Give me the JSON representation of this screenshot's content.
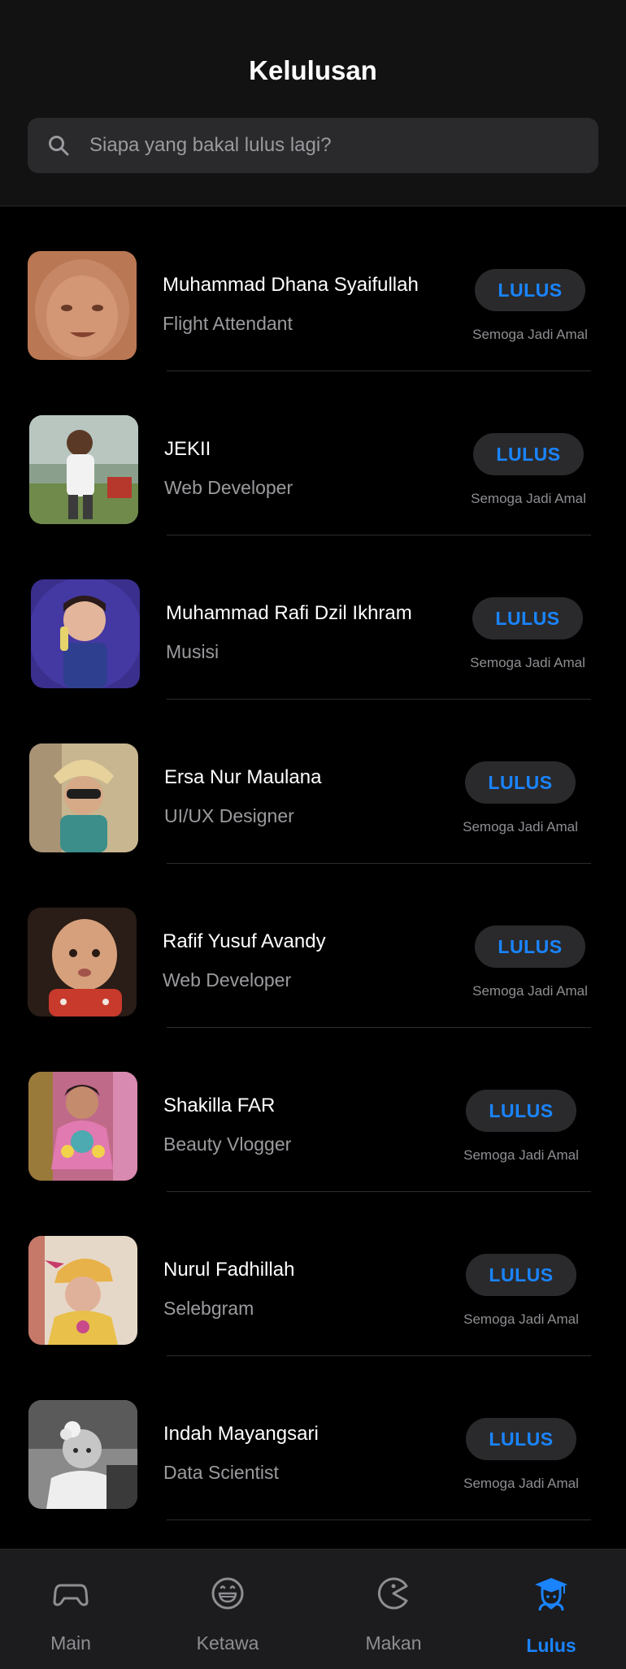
{
  "header": {
    "title": "Kelulusan"
  },
  "search": {
    "placeholder": "Siapa yang bakal lulus lagi?",
    "icon": "search-icon"
  },
  "list": [
    {
      "name": "Muhammad Dhana Syaifullah",
      "role": "Flight Attendant",
      "badge": "LULUS",
      "caption": "Semoga Jadi Amal",
      "avatar": "photo-baby-face"
    },
    {
      "name": "JEKII",
      "role": "Web Developer",
      "badge": "LULUS",
      "caption": "Semoga Jadi Amal",
      "avatar": "photo-child-outdoors"
    },
    {
      "name": "Muhammad Rafi Dzil Ikhram",
      "role": "Musisi",
      "badge": "LULUS",
      "caption": "Semoga Jadi Amal",
      "avatar": "photo-child-blue-background"
    },
    {
      "name": "Ersa Nur Maulana",
      "role": "UI/UX Designer",
      "badge": "LULUS",
      "caption": "Semoga Jadi Amal",
      "avatar": "photo-child-sunglasses"
    },
    {
      "name": "Rafif Yusuf Avandy",
      "role": "Web Developer",
      "badge": "LULUS",
      "caption": "Semoga Jadi Amal",
      "avatar": "photo-baby-red-shirt"
    },
    {
      "name": "Shakilla FAR",
      "role": "Beauty Vlogger",
      "badge": "LULUS",
      "caption": "Semoga Jadi Amal",
      "avatar": "photo-child-costume"
    },
    {
      "name": "Nurul Fadhillah",
      "role": "Selebgram",
      "badge": "LULUS",
      "caption": "Semoga Jadi Amal",
      "avatar": "photo-child-yellow-dress"
    },
    {
      "name": "Indah Mayangsari",
      "role": "Data Scientist",
      "badge": "LULUS",
      "caption": "Semoga Jadi Amal",
      "avatar": "photo-baby-black-white"
    }
  ],
  "tabbar": {
    "tabs": [
      {
        "label": "Main",
        "icon": "gamepad-icon",
        "active": false
      },
      {
        "label": "Ketawa",
        "icon": "smiley-icon",
        "active": false
      },
      {
        "label": "Makan",
        "icon": "pacman-icon",
        "active": false
      },
      {
        "label": "Lulus",
        "icon": "graduate-icon",
        "active": true
      }
    ]
  },
  "colors": {
    "accent": "#1a84ff",
    "background": "#000000",
    "header_bg": "#121212",
    "badge_bg": "#2a2a2c",
    "tabbar_bg": "#1c1c1e",
    "secondary_text": "#9b9b9f"
  }
}
